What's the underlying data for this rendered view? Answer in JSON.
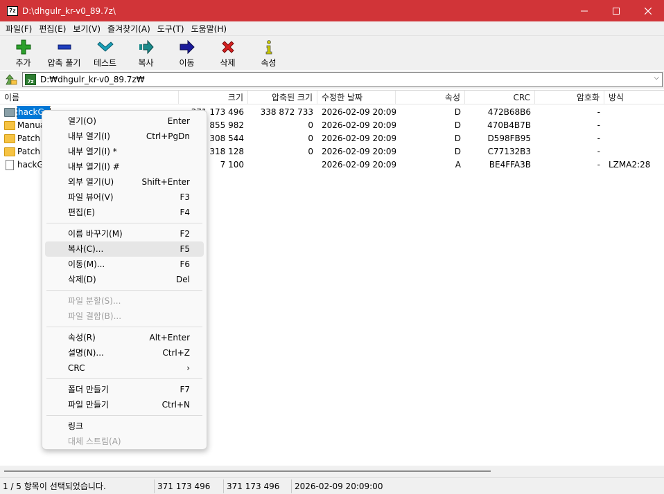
{
  "window": {
    "title": "D:\\dhgulr_kr-v0_89.7z\\",
    "app_icon": "7z"
  },
  "menubar": [
    "파일(F)",
    "편집(E)",
    "보기(V)",
    "즐겨찾기(A)",
    "도구(T)",
    "도움말(H)"
  ],
  "toolbar": [
    {
      "label": "추가",
      "icon": "plus-icon",
      "color": "#2ca02c"
    },
    {
      "label": "압축 풀기",
      "icon": "minus-icon",
      "color": "#1f3fbf"
    },
    {
      "label": "테스트",
      "icon": "check-chevron-icon",
      "color": "#1aa0b8"
    },
    {
      "label": "복사",
      "icon": "copy-arrow-icon",
      "color": "#1a8a8a"
    },
    {
      "label": "이동",
      "icon": "move-arrow-icon",
      "color": "#1a1a9a"
    },
    {
      "label": "삭제",
      "icon": "delete-x-icon",
      "color": "#d62020"
    },
    {
      "label": "속성",
      "icon": "info-icon",
      "color": "#c8c800"
    }
  ],
  "address": {
    "path": "D:₩dhgulr_kr-v0_89.7z₩"
  },
  "columns": [
    "이름",
    "크기",
    "압축된 크기",
    "수정한 날짜",
    "속성",
    "CRC",
    "암호화",
    "방식"
  ],
  "rows": [
    {
      "name": "hackGu",
      "size": "371 173 496",
      "packed": "338 872 733",
      "modified": "2026-02-09 20:09",
      "attr": "D",
      "crc": "472B68B6",
      "encrypted": "-",
      "method": "",
      "type": "folder",
      "selected": true
    },
    {
      "name": "Manua",
      "size": "2 855 982",
      "packed": "0",
      "modified": "2026-02-09 20:09",
      "attr": "D",
      "crc": "470B4B7B",
      "encrypted": "-",
      "method": "",
      "type": "folder",
      "selected": false
    },
    {
      "name": "Patch",
      "size": "308 544",
      "packed": "0",
      "modified": "2026-02-09 20:09",
      "attr": "D",
      "crc": "D598FB95",
      "encrypted": "-",
      "method": "",
      "type": "folder",
      "selected": false
    },
    {
      "name": "Patch",
      "size": "318 128",
      "packed": "0",
      "modified": "2026-02-09 20:09",
      "attr": "D",
      "crc": "C77132B3",
      "encrypted": "-",
      "method": "",
      "type": "folder",
      "selected": false
    },
    {
      "name": "hackG",
      "size": "7 100",
      "packed": "",
      "modified": "2026-02-09 20:09",
      "attr": "A",
      "crc": "BE4FFA3B",
      "encrypted": "-",
      "method": "LZMA2:28",
      "type": "file",
      "selected": false
    }
  ],
  "context_menu": [
    {
      "label": "열기(O)",
      "shortcut": "Enter"
    },
    {
      "label": "내부 열기(I)",
      "shortcut": "Ctrl+PgDn"
    },
    {
      "label": "내부 열기(I) *",
      "shortcut": ""
    },
    {
      "label": "내부 열기(I) #",
      "shortcut": ""
    },
    {
      "label": "외부 열기(U)",
      "shortcut": "Shift+Enter"
    },
    {
      "label": "파일 뷰어(V)",
      "shortcut": "F3"
    },
    {
      "label": "편집(E)",
      "shortcut": "F4"
    },
    {
      "separator": true
    },
    {
      "label": "이름 바꾸기(M)",
      "shortcut": "F2"
    },
    {
      "label": "복사(C)...",
      "shortcut": "F5",
      "hover": true
    },
    {
      "label": "이동(M)...",
      "shortcut": "F6"
    },
    {
      "label": "삭제(D)",
      "shortcut": "Del"
    },
    {
      "separator": true
    },
    {
      "label": "파일 분할(S)...",
      "shortcut": "",
      "disabled": true
    },
    {
      "label": "파일 결합(B)...",
      "shortcut": "",
      "disabled": true
    },
    {
      "separator": true
    },
    {
      "label": "속성(R)",
      "shortcut": "Alt+Enter"
    },
    {
      "label": "설명(N)...",
      "shortcut": "Ctrl+Z"
    },
    {
      "label": "CRC",
      "shortcut": "›"
    },
    {
      "separator": true
    },
    {
      "label": "폴더 만들기",
      "shortcut": "F7"
    },
    {
      "label": "파일 만들기",
      "shortcut": "Ctrl+N"
    },
    {
      "separator": true
    },
    {
      "label": "링크",
      "shortcut": ""
    },
    {
      "label": "대체 스트림(A)",
      "shortcut": "",
      "disabled": true
    }
  ],
  "status": {
    "selection": "1 / 5 항목이 선택되었습니다.",
    "size": "371 173 496",
    "packed": "371 173 496",
    "modified": "2026-02-09 20:09:00"
  }
}
